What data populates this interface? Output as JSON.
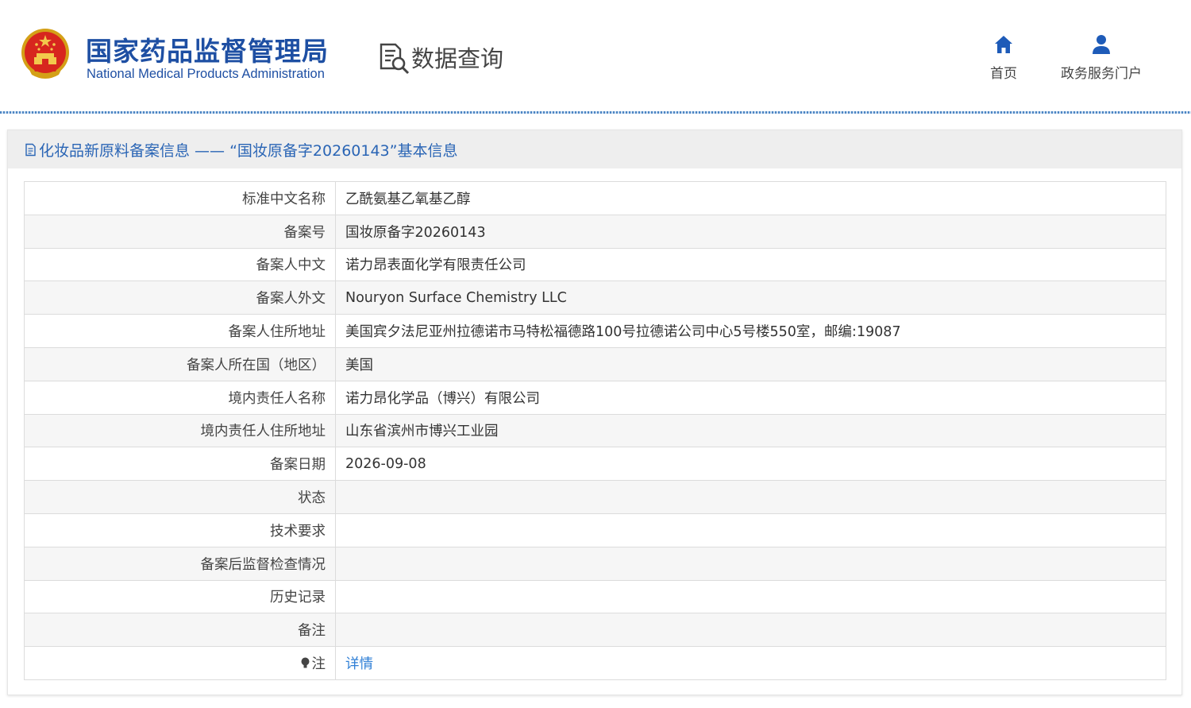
{
  "header": {
    "brand_cn": "国家药品监督管理局",
    "brand_en": "National Medical Products Administration",
    "query_title": "数据查询",
    "nav": [
      {
        "label": "首页",
        "icon": "home-icon"
      },
      {
        "label": "政务服务门户",
        "icon": "user-icon"
      }
    ]
  },
  "panel": {
    "title": "化妆品新原料备案信息 —— “国妆原备字20260143”基本信息"
  },
  "rows": [
    {
      "label": "标准中文名称",
      "value": "乙酰氨基乙氧基乙醇"
    },
    {
      "label": "备案号",
      "value": "国妆原备字20260143"
    },
    {
      "label": "备案人中文",
      "value": "诺力昂表面化学有限责任公司"
    },
    {
      "label": "备案人外文",
      "value": "Nouryon Surface Chemistry LLC"
    },
    {
      "label": "备案人住所地址",
      "value": "美国宾夕法尼亚州拉德诺市马特松福德路100号拉德诺公司中心5号楼550室，邮编:19087"
    },
    {
      "label": "备案人所在国（地区）",
      "value": "美国"
    },
    {
      "label": "境内责任人名称",
      "value": "诺力昂化学品（博兴）有限公司"
    },
    {
      "label": "境内责任人住所地址",
      "value": "山东省滨州市博兴工业园"
    },
    {
      "label": "备案日期",
      "value": "2026-09-08"
    },
    {
      "label": "状态",
      "value": ""
    },
    {
      "label": "技术要求",
      "value": ""
    },
    {
      "label": "备案后监督检查情况",
      "value": ""
    },
    {
      "label": "历史记录",
      "value": ""
    },
    {
      "label": "备注",
      "value": ""
    }
  ],
  "note": {
    "label": "注",
    "link": "详情"
  },
  "colors": {
    "brand_blue": "#1e4fa3",
    "title_blue": "#2a65b5",
    "link_blue": "#2f7fd6",
    "header_bg": "#eeeeee",
    "stripe": "#f6f6f6"
  }
}
